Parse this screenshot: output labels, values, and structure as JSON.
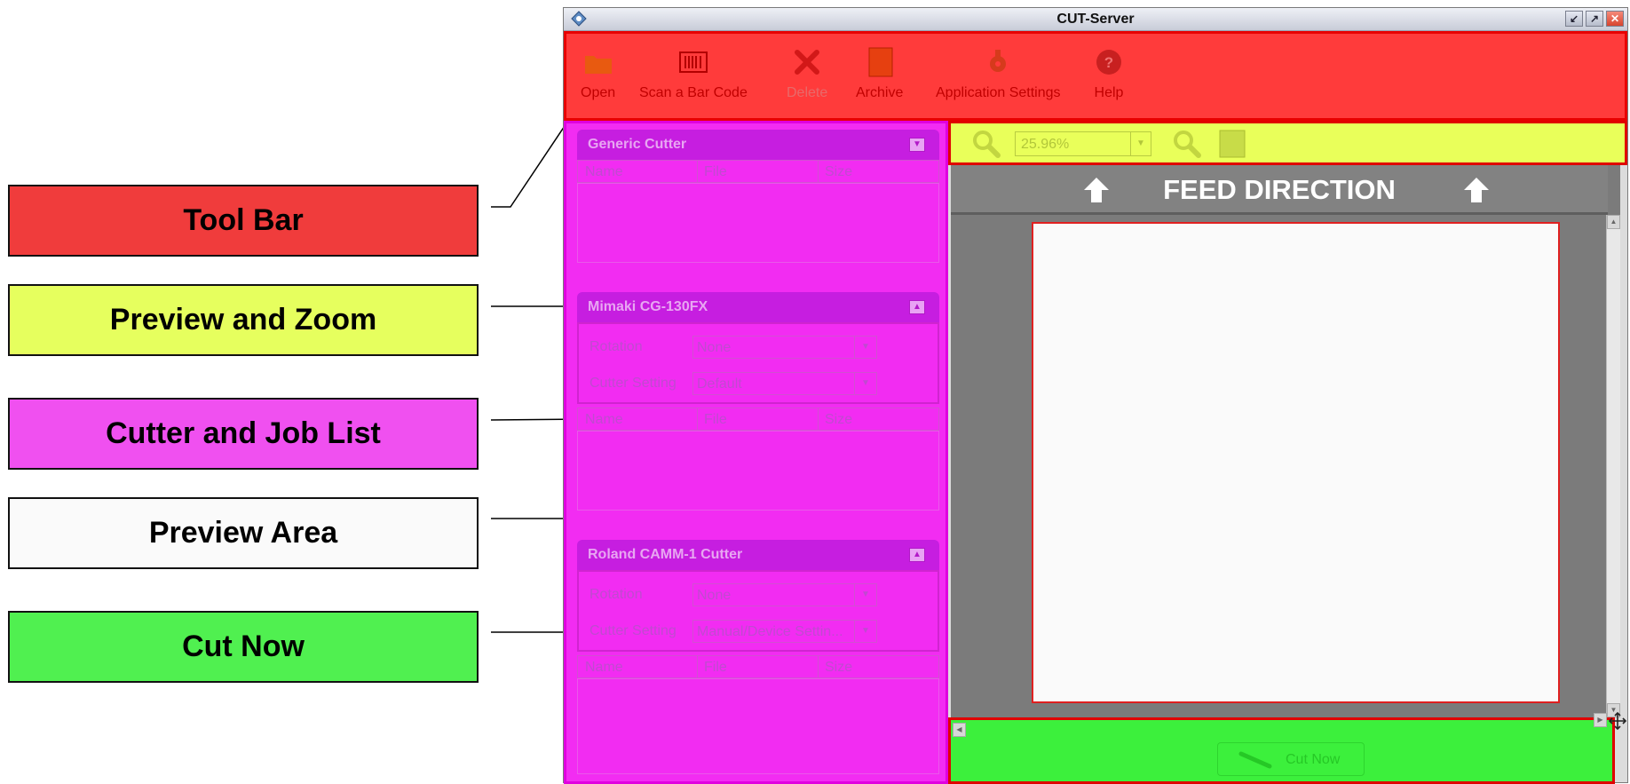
{
  "legend": {
    "tool_bar": "Tool Bar",
    "preview_and_zoom": "Preview and Zoom",
    "cutter_and_job_list": "Cutter and Job List",
    "preview_area": "Preview Area",
    "cut_now": "Cut Now"
  },
  "window": {
    "title": "CUT-Server"
  },
  "toolbar": {
    "items": [
      {
        "label": "Open",
        "icon": "folder-icon"
      },
      {
        "label": "Scan a Bar Code",
        "icon": "barcode-icon"
      },
      {
        "label": "Delete",
        "icon": "delete-icon",
        "disabled": true
      },
      {
        "label": "Archive",
        "icon": "archive-icon"
      },
      {
        "label": "Application Settings",
        "icon": "settings-icon"
      },
      {
        "label": "Help",
        "icon": "help-icon"
      }
    ]
  },
  "columns": {
    "name": "Name",
    "file": "File",
    "size": "Size"
  },
  "cutters": [
    {
      "name": "Generic Cutter"
    },
    {
      "name": "Mimaki CG-130FX",
      "rotation_label": "Rotation",
      "rotation_value": "None",
      "setting_label": "Cutter Setting",
      "setting_value": "Default"
    },
    {
      "name": "Roland CAMM-1 Cutter",
      "rotation_label": "Rotation",
      "rotation_value": "None",
      "setting_label": "Cutter Setting",
      "setting_value": "Manual/Device Settin..."
    }
  ],
  "zoom": {
    "value": "25.96%"
  },
  "preview": {
    "feed_direction": "FEED DIRECTION"
  },
  "cut": {
    "label": "Cut Now"
  },
  "colors": {
    "toolbar": "#ff3b3b",
    "left_panel": "#f22cf2",
    "zoom_bar": "#e9ff5a",
    "cut_bar": "#3cf03c",
    "preview_bg": "#7b7b7b"
  }
}
